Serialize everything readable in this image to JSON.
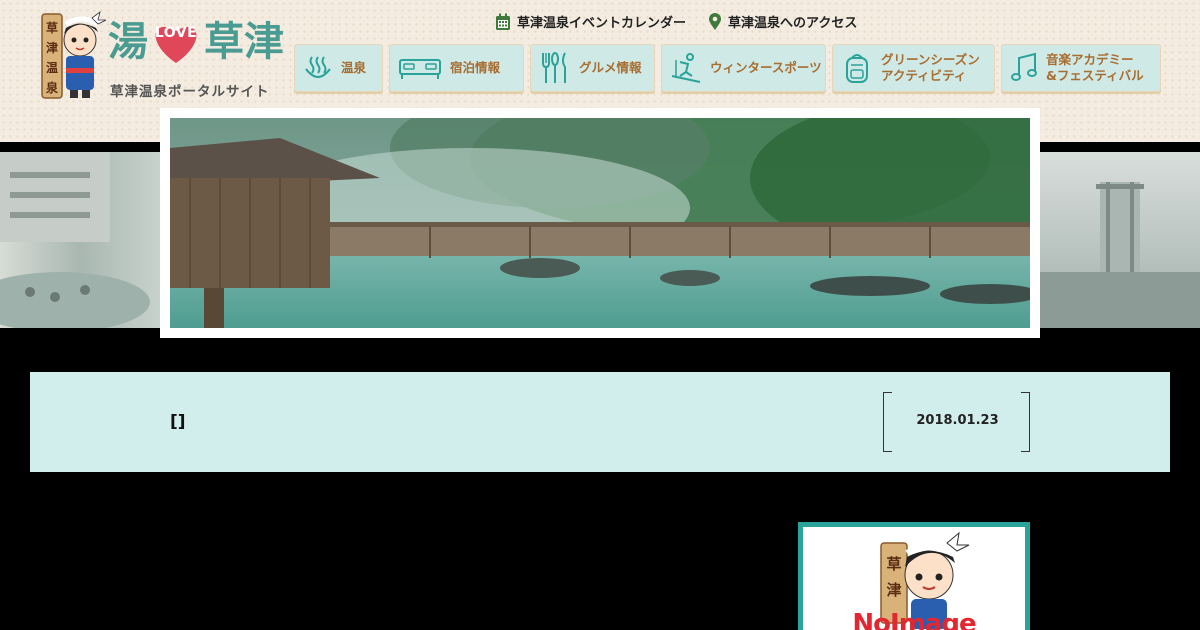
{
  "logo": {
    "yu": "湯",
    "love": "LOVE",
    "kusatsu": "草津",
    "subtitle": "草津温泉ポータルサイト",
    "badge_chars": [
      "草",
      "津",
      "温",
      "泉"
    ]
  },
  "top_links": [
    {
      "label": "草津温泉イベントカレンダー",
      "icon": "calendar-icon"
    },
    {
      "label": "草津温泉へのアクセス",
      "icon": "map-pin-icon"
    }
  ],
  "nav": [
    {
      "label": "温泉",
      "icon": "hot-spring-icon"
    },
    {
      "label": "宿泊情報",
      "icon": "bed-icon"
    },
    {
      "label": "グルメ情報",
      "icon": "cutlery-icon"
    },
    {
      "label": "ウィンタースポーツ",
      "icon": "skier-icon"
    },
    {
      "label": "グリーンシーズン",
      "label2": "アクティビティ",
      "icon": "backpack-icon"
    },
    {
      "label": "音楽アカデミー",
      "label2": "&フェスティバル",
      "icon": "music-note-icon"
    }
  ],
  "article": {
    "title": "[]",
    "date": "2018.01.23"
  },
  "no_image": {
    "text": "NoImage",
    "badge_chars": [
      "草",
      "津"
    ]
  },
  "colors": {
    "accent_teal": "#4a9c92",
    "nav_bg": "#cfe9e6",
    "nav_text": "#a86d31",
    "title_bg": "#d2eeec",
    "heart_red": "#e0485a",
    "no_image_border": "#2aa39a",
    "no_image_text": "#e3262f"
  }
}
